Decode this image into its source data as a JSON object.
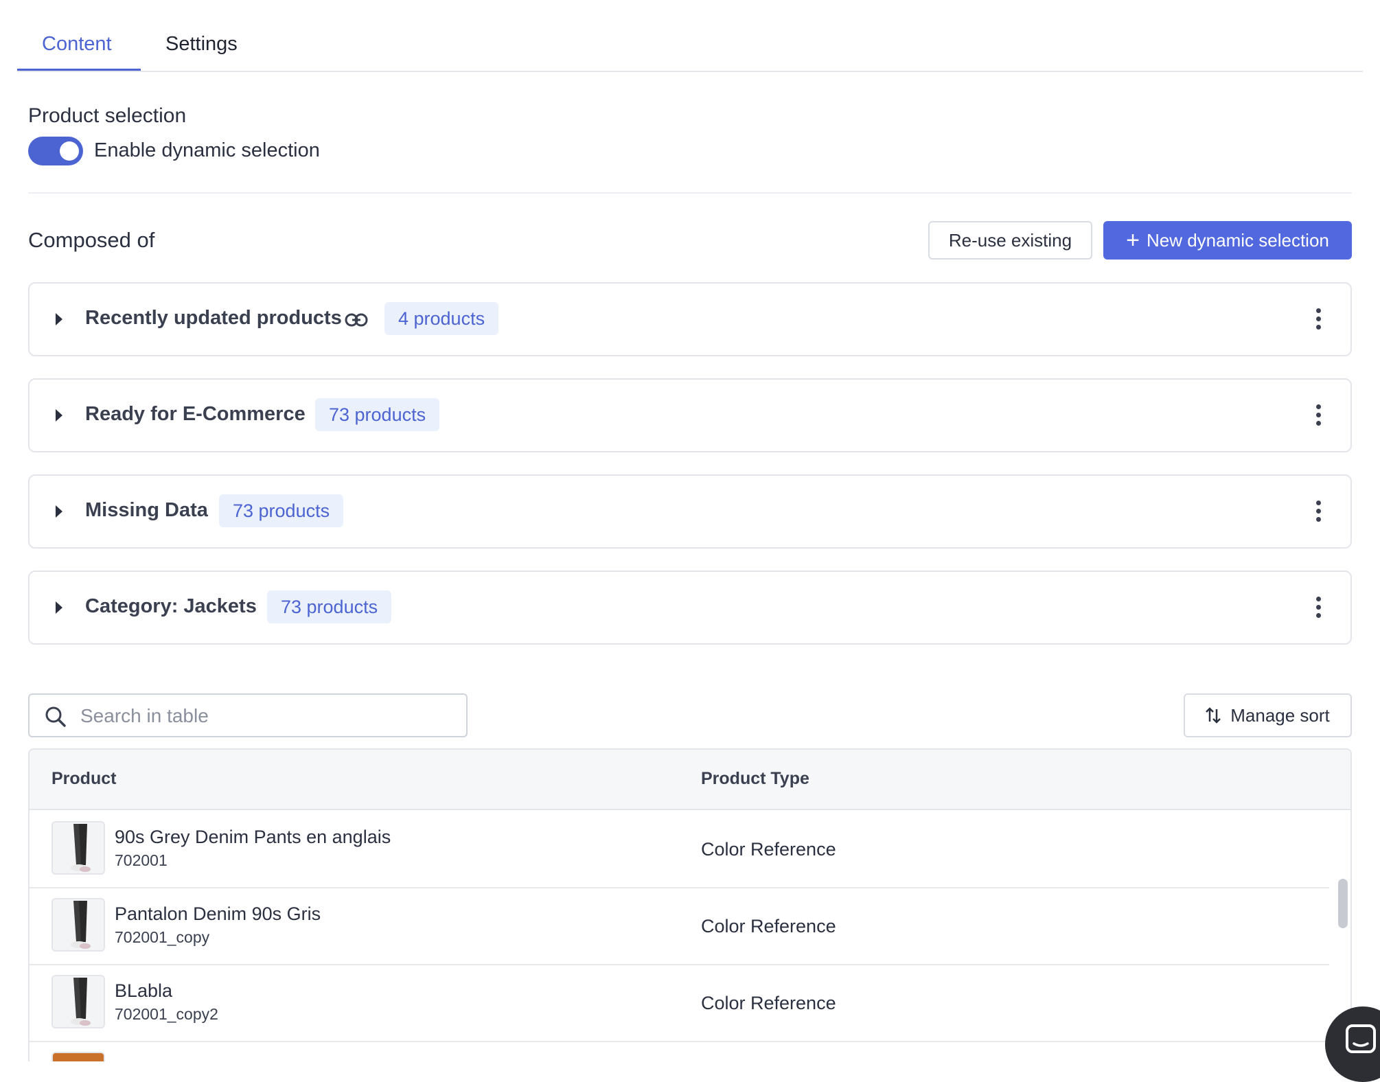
{
  "tabs": [
    {
      "label": "Content",
      "active": true
    },
    {
      "label": "Settings",
      "active": false
    }
  ],
  "product_selection": {
    "title": "Product selection",
    "toggle_label": "Enable dynamic selection",
    "toggle_on": true
  },
  "composed": {
    "title": "Composed of",
    "reuse_label": "Re-use existing",
    "new_label": "New dynamic selection"
  },
  "selections": [
    {
      "name": "Recently updated products",
      "count": "4 products",
      "linked": true
    },
    {
      "name": "Ready for E-Commerce",
      "count": "73 products",
      "linked": false
    },
    {
      "name": "Missing Data",
      "count": "73 products",
      "linked": false
    },
    {
      "name": "Category: Jackets",
      "count": "73 products",
      "linked": false
    }
  ],
  "search": {
    "placeholder": "Search in table",
    "value": ""
  },
  "sort": {
    "label": "Manage sort"
  },
  "table": {
    "headers": [
      "Product",
      "Product Type"
    ],
    "rows": [
      {
        "name": "90s Grey Denim Pants en anglais",
        "code": "702001",
        "type": "Color Reference"
      },
      {
        "name": "Pantalon Denim 90s Gris",
        "code": "702001_copy",
        "type": "Color Reference"
      },
      {
        "name": "BLabla",
        "code": "702001_copy2",
        "type": "Color Reference"
      }
    ]
  },
  "colors": {
    "accent": "#4c63d2",
    "button_primary": "#5168de",
    "badge_bg": "#ebf0fd"
  },
  "icons": [
    "link-icon",
    "kebab-menu-icon",
    "caret-right-icon",
    "search-icon",
    "sort-icon",
    "plus-icon",
    "chat-icon"
  ]
}
